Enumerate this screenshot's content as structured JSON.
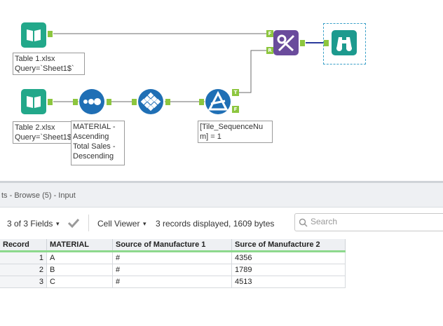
{
  "workflow": {
    "input1": {
      "icon": "book-icon",
      "annotation": "Table 1.xlsx\nQuery=`Sheet1$`"
    },
    "input2": {
      "icon": "book-icon",
      "annotation": "Table 2.xlsx\nQuery=`Sheet1$"
    },
    "sort": {
      "icon": "sort-dots-icon",
      "annotation": "MATERIAL -\nAscending\nTotal Sales -\nDescending"
    },
    "tile": {
      "icon": "tile-diamond-icon"
    },
    "filter": {
      "icon": "filter-icon",
      "annotation": "[Tile_SequenceNu\nm] = 1",
      "true_label": "T",
      "false_label": "F"
    },
    "join": {
      "icon": "join-icon",
      "left_label": "F",
      "right_label": "R"
    },
    "browse": {
      "icon": "binoculars-icon"
    }
  },
  "results": {
    "title": "ts - Browse (5) - Input",
    "fields_label": "3 of 3 Fields",
    "viewer_label": "Cell Viewer",
    "records_info": "3 records displayed, 1609 bytes",
    "search_placeholder": "Search"
  },
  "table": {
    "columns": [
      "Record",
      "MATERIAL",
      "Source of Manufacture 1",
      "Surce of Manufacture 2"
    ],
    "rows": [
      [
        "1",
        "A",
        "#",
        "4356"
      ],
      [
        "2",
        "B",
        "#",
        "1789"
      ],
      [
        "3",
        "C",
        "#",
        "4513"
      ]
    ]
  },
  "colors": {
    "accent_green": "#8dc63f",
    "input_teal": "#22a88a",
    "sort_blue": "#1f6fb5",
    "join_purple": "#6a4b9c",
    "browse_teal": "#1c9a8e"
  }
}
